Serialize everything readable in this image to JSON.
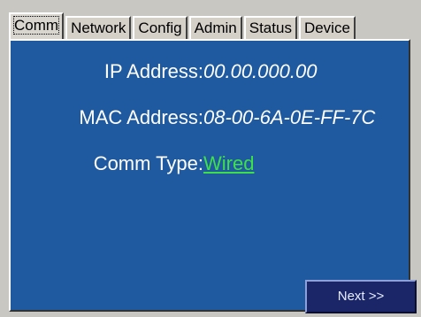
{
  "tabs": [
    {
      "label": "Comm",
      "active": true
    },
    {
      "label": "Network",
      "active": false
    },
    {
      "label": "Config",
      "active": false
    },
    {
      "label": "Admin",
      "active": false
    },
    {
      "label": "Status",
      "active": false
    },
    {
      "label": "Device",
      "active": false
    }
  ],
  "fields": {
    "ip_label": "IP Address:",
    "ip_value": "00.00.000.00",
    "mac_label": "MAC Address:",
    "mac_value": "08-00-6A-0E-FF-7C",
    "comm_label": "Comm Type:",
    "comm_value": "Wired"
  },
  "buttons": {
    "next_label": "Next >>"
  },
  "colors": {
    "panel_bg": "#1f5aa0",
    "link_green": "#3ee04a",
    "button_bg": "#1a2668"
  }
}
